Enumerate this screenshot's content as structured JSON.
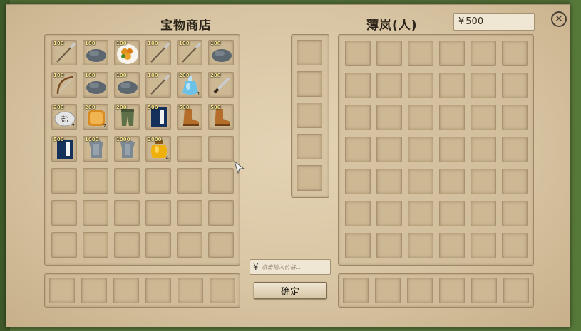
{
  "shop": {
    "title": "宝物商店",
    "items": [
      {
        "price": "100",
        "icon": "spear-icon",
        "qty": ""
      },
      {
        "price": "100",
        "icon": "rock-icon",
        "qty": ""
      },
      {
        "price": "100",
        "icon": "food-plate-icon",
        "qty": ""
      },
      {
        "price": "100",
        "icon": "spear-icon",
        "qty": ""
      },
      {
        "price": "100",
        "icon": "spear-icon",
        "qty": ""
      },
      {
        "price": "100",
        "icon": "rock-icon",
        "qty": ""
      },
      {
        "price": "100",
        "icon": "bow-icon",
        "qty": ""
      },
      {
        "price": "100",
        "icon": "rock-icon",
        "qty": ""
      },
      {
        "price": "100",
        "icon": "rock-icon",
        "qty": ""
      },
      {
        "price": "100",
        "icon": "spear-icon",
        "qty": ""
      },
      {
        "price": "200",
        "icon": "potion-icon",
        "qty": "1"
      },
      {
        "price": "200",
        "icon": "dagger-icon",
        "qty": ""
      },
      {
        "price": "200",
        "icon": "salt-icon",
        "qty": "7"
      },
      {
        "price": "200",
        "icon": "bread-icon",
        "qty": "7"
      },
      {
        "price": "200",
        "icon": "leggings-icon",
        "qty": ""
      },
      {
        "price": "500",
        "icon": "book-icon",
        "qty": ""
      },
      {
        "price": "500",
        "icon": "boots-icon",
        "qty": ""
      },
      {
        "price": "500",
        "icon": "boots-icon",
        "qty": ""
      },
      {
        "price": "500",
        "icon": "book-icon",
        "qty": ""
      },
      {
        "price": "1000",
        "icon": "armor-icon",
        "qty": ""
      },
      {
        "price": "1000",
        "icon": "armor-icon",
        "qty": ""
      },
      {
        "price": "2000",
        "icon": "honey-jar-icon",
        "qty": "4"
      }
    ]
  },
  "player": {
    "name": "薄岚(人)",
    "currency_symbol": "¥",
    "money": "500"
  },
  "trade": {
    "currency_symbol": "¥",
    "price_placeholder": "点击输入价格...",
    "confirm_label": "确定",
    "close_symbol": "✕"
  }
}
